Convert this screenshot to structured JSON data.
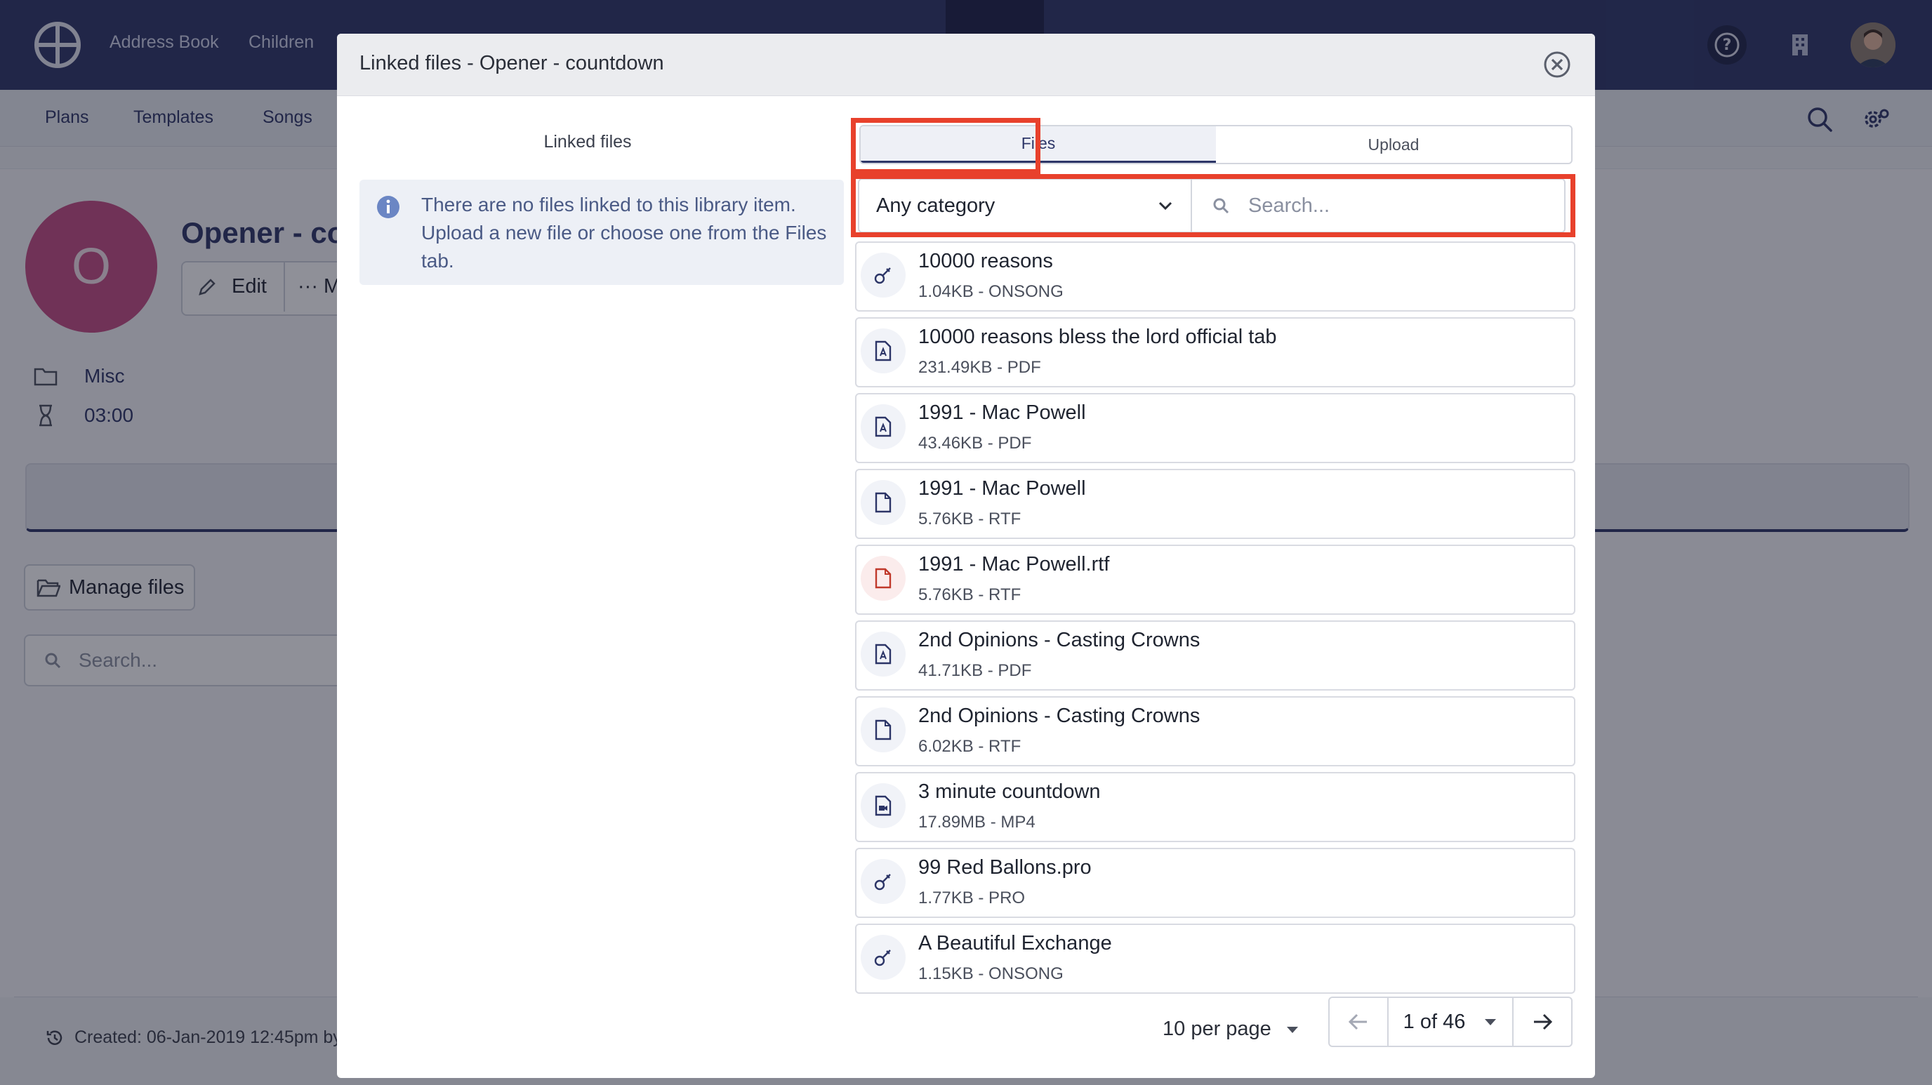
{
  "topnav": {
    "links": [
      "Address Book",
      "Children"
    ]
  },
  "subnav": {
    "links": [
      "Plans",
      "Templates",
      "Songs"
    ]
  },
  "item": {
    "title": "Opener - co",
    "avatar_letter": "O",
    "edit_label": "Edit",
    "more_label": "··· M",
    "category": "Misc",
    "duration": "03:00"
  },
  "background": {
    "manage_files": "Manage files",
    "search_placeholder": "Search...",
    "created": "Created: 06-Jan-2019 12:45pm by"
  },
  "modal": {
    "title": "Linked files - Opener - countdown",
    "left_heading": "Linked files",
    "info_message": "There are no files linked to this library item. Upload a new file or choose one from the Files tab.",
    "tabs": [
      {
        "label": "Files",
        "active": true
      },
      {
        "label": "Upload",
        "active": false
      }
    ],
    "category_select": "Any category",
    "search_placeholder": "Search...",
    "files": [
      {
        "name": "10000 reasons",
        "meta": "1.04KB - ONSONG",
        "icon": "guitar-icon"
      },
      {
        "name": "10000 reasons bless the lord official tab",
        "meta": "231.49KB - PDF",
        "icon": "pdf-icon"
      },
      {
        "name": "1991 - Mac Powell",
        "meta": "43.46KB - PDF",
        "icon": "pdf-icon"
      },
      {
        "name": "1991 - Mac Powell",
        "meta": "5.76KB - RTF",
        "icon": "document-icon"
      },
      {
        "name": "1991 - Mac Powell.rtf",
        "meta": "5.76KB - RTF",
        "icon": "document-icon-red"
      },
      {
        "name": "2nd Opinions - Casting Crowns",
        "meta": "41.71KB - PDF",
        "icon": "pdf-icon"
      },
      {
        "name": "2nd Opinions - Casting Crowns",
        "meta": "6.02KB - RTF",
        "icon": "document-icon"
      },
      {
        "name": "3 minute countdown",
        "meta": "17.89MB - MP4",
        "icon": "video-file-icon"
      },
      {
        "name": "99 Red Ballons.pro",
        "meta": "1.77KB - PRO",
        "icon": "guitar-icon"
      },
      {
        "name": "A Beautiful Exchange",
        "meta": "1.15KB - ONSONG",
        "icon": "guitar-icon"
      }
    ],
    "pagination": {
      "per_page": "10 per page",
      "page": "1 of 46"
    }
  },
  "colors": {
    "nav": "#2c3567",
    "highlight": "#e8412c",
    "avatar": "#c44b82"
  }
}
